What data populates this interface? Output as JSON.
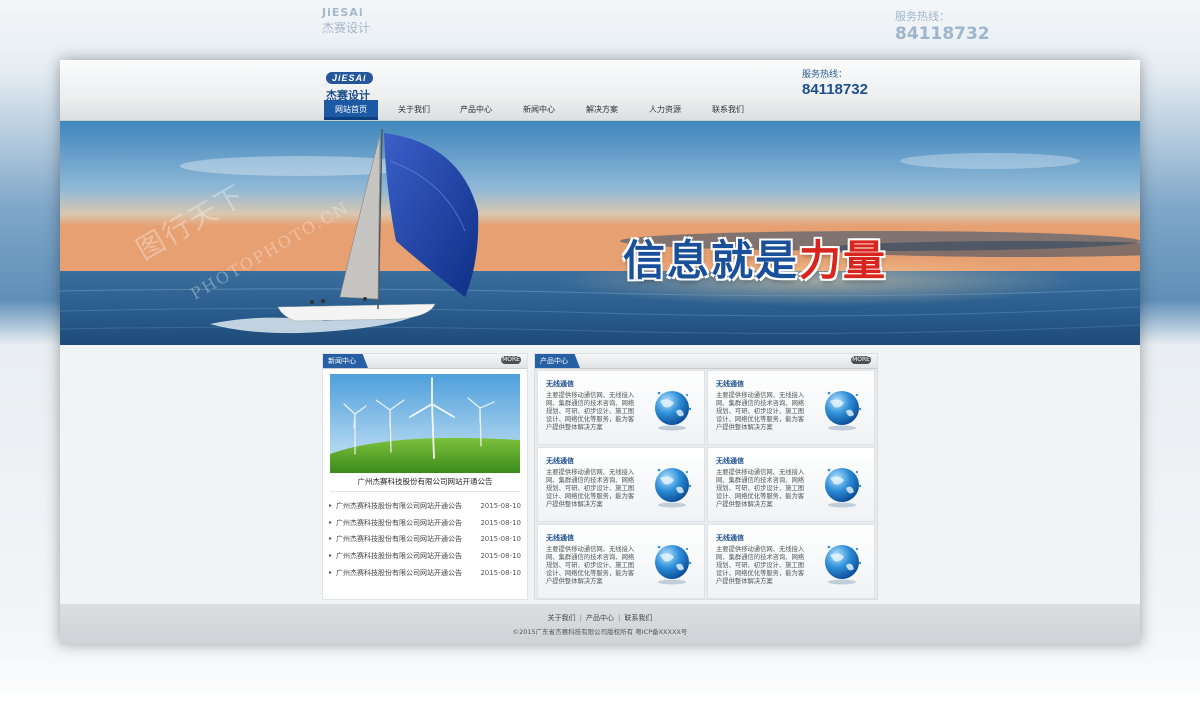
{
  "header": {
    "logo_en": "JiESAi",
    "logo_cn": "杰赛设计",
    "hotline_label": "服务热线：",
    "hotline_number": "84118732"
  },
  "nav": {
    "items": [
      "网站首页",
      "关于我们",
      "产品中心",
      "新闻中心",
      "解决方案",
      "人力资源",
      "联系我们"
    ],
    "active": "网站首页"
  },
  "banner": {
    "slogan_part1": "信息就是",
    "slogan_part2": "力量",
    "watermark_text": "PHOTOPHOTO.CN",
    "watermark_logo": "图行天下"
  },
  "news": {
    "title": "新闻中心",
    "more": "MORE",
    "featured_caption": "广州杰赛科技股份有限公司网站开通公告",
    "items": [
      {
        "title": "广州杰赛科技股份有限公司网站开通公告",
        "date": "2015-08-10"
      },
      {
        "title": "广州杰赛科技股份有限公司网站开通公告",
        "date": "2015-08-10"
      },
      {
        "title": "广州杰赛科技股份有限公司网站开通公告",
        "date": "2015-08-10"
      },
      {
        "title": "广州杰赛科技股份有限公司网站开通公告",
        "date": "2015-08-10"
      },
      {
        "title": "广州杰赛科技股份有限公司网站开通公告",
        "date": "2015-08-10"
      }
    ]
  },
  "products": {
    "title": "产品中心",
    "more": "MORE",
    "items": [
      {
        "title": "无线通信",
        "desc": "主要提供移动通信网、无线接入网、集群通信的技术咨询、网络规划、可研、初步设计、施工图设计、网络优化等服务，能为客户提供整体解决方案"
      },
      {
        "title": "无线通信",
        "desc": "主要提供移动通信网、无线接入网、集群通信的技术咨询、网络规划、可研、初步设计、施工图设计、网络优化等服务，能为客户提供整体解决方案"
      },
      {
        "title": "无线通信",
        "desc": "主要提供移动通信网、无线接入网、集群通信的技术咨询、网络规划、可研、初步设计、施工图设计、网络优化等服务，能为客户提供整体解决方案"
      },
      {
        "title": "无线通信",
        "desc": "主要提供移动通信网、无线接入网、集群通信的技术咨询、网络规划、可研、初步设计、施工图设计、网络优化等服务，能为客户提供整体解决方案"
      },
      {
        "title": "无线通信",
        "desc": "主要提供移动通信网、无线接入网、集群通信的技术咨询、网络规划、可研、初步设计、施工图设计、网络优化等服务，能为客户提供整体解决方案"
      },
      {
        "title": "无线通信",
        "desc": "主要提供移动通信网、无线接入网、集群通信的技术咨询、网络规划、可研、初步设计、施工图设计、网络优化等服务，能为客户提供整体解决方案"
      }
    ]
  },
  "footer": {
    "links": [
      "关于我们",
      "产品中心",
      "联系我们"
    ],
    "copyright": "©2015广东省杰赛科技有限公司版权所有 粤ICP备XXXXX号"
  },
  "colors": {
    "brand_blue": "#1e5aa3",
    "slogan_blue": "#1a4f9a",
    "slogan_red": "#d8251d"
  }
}
